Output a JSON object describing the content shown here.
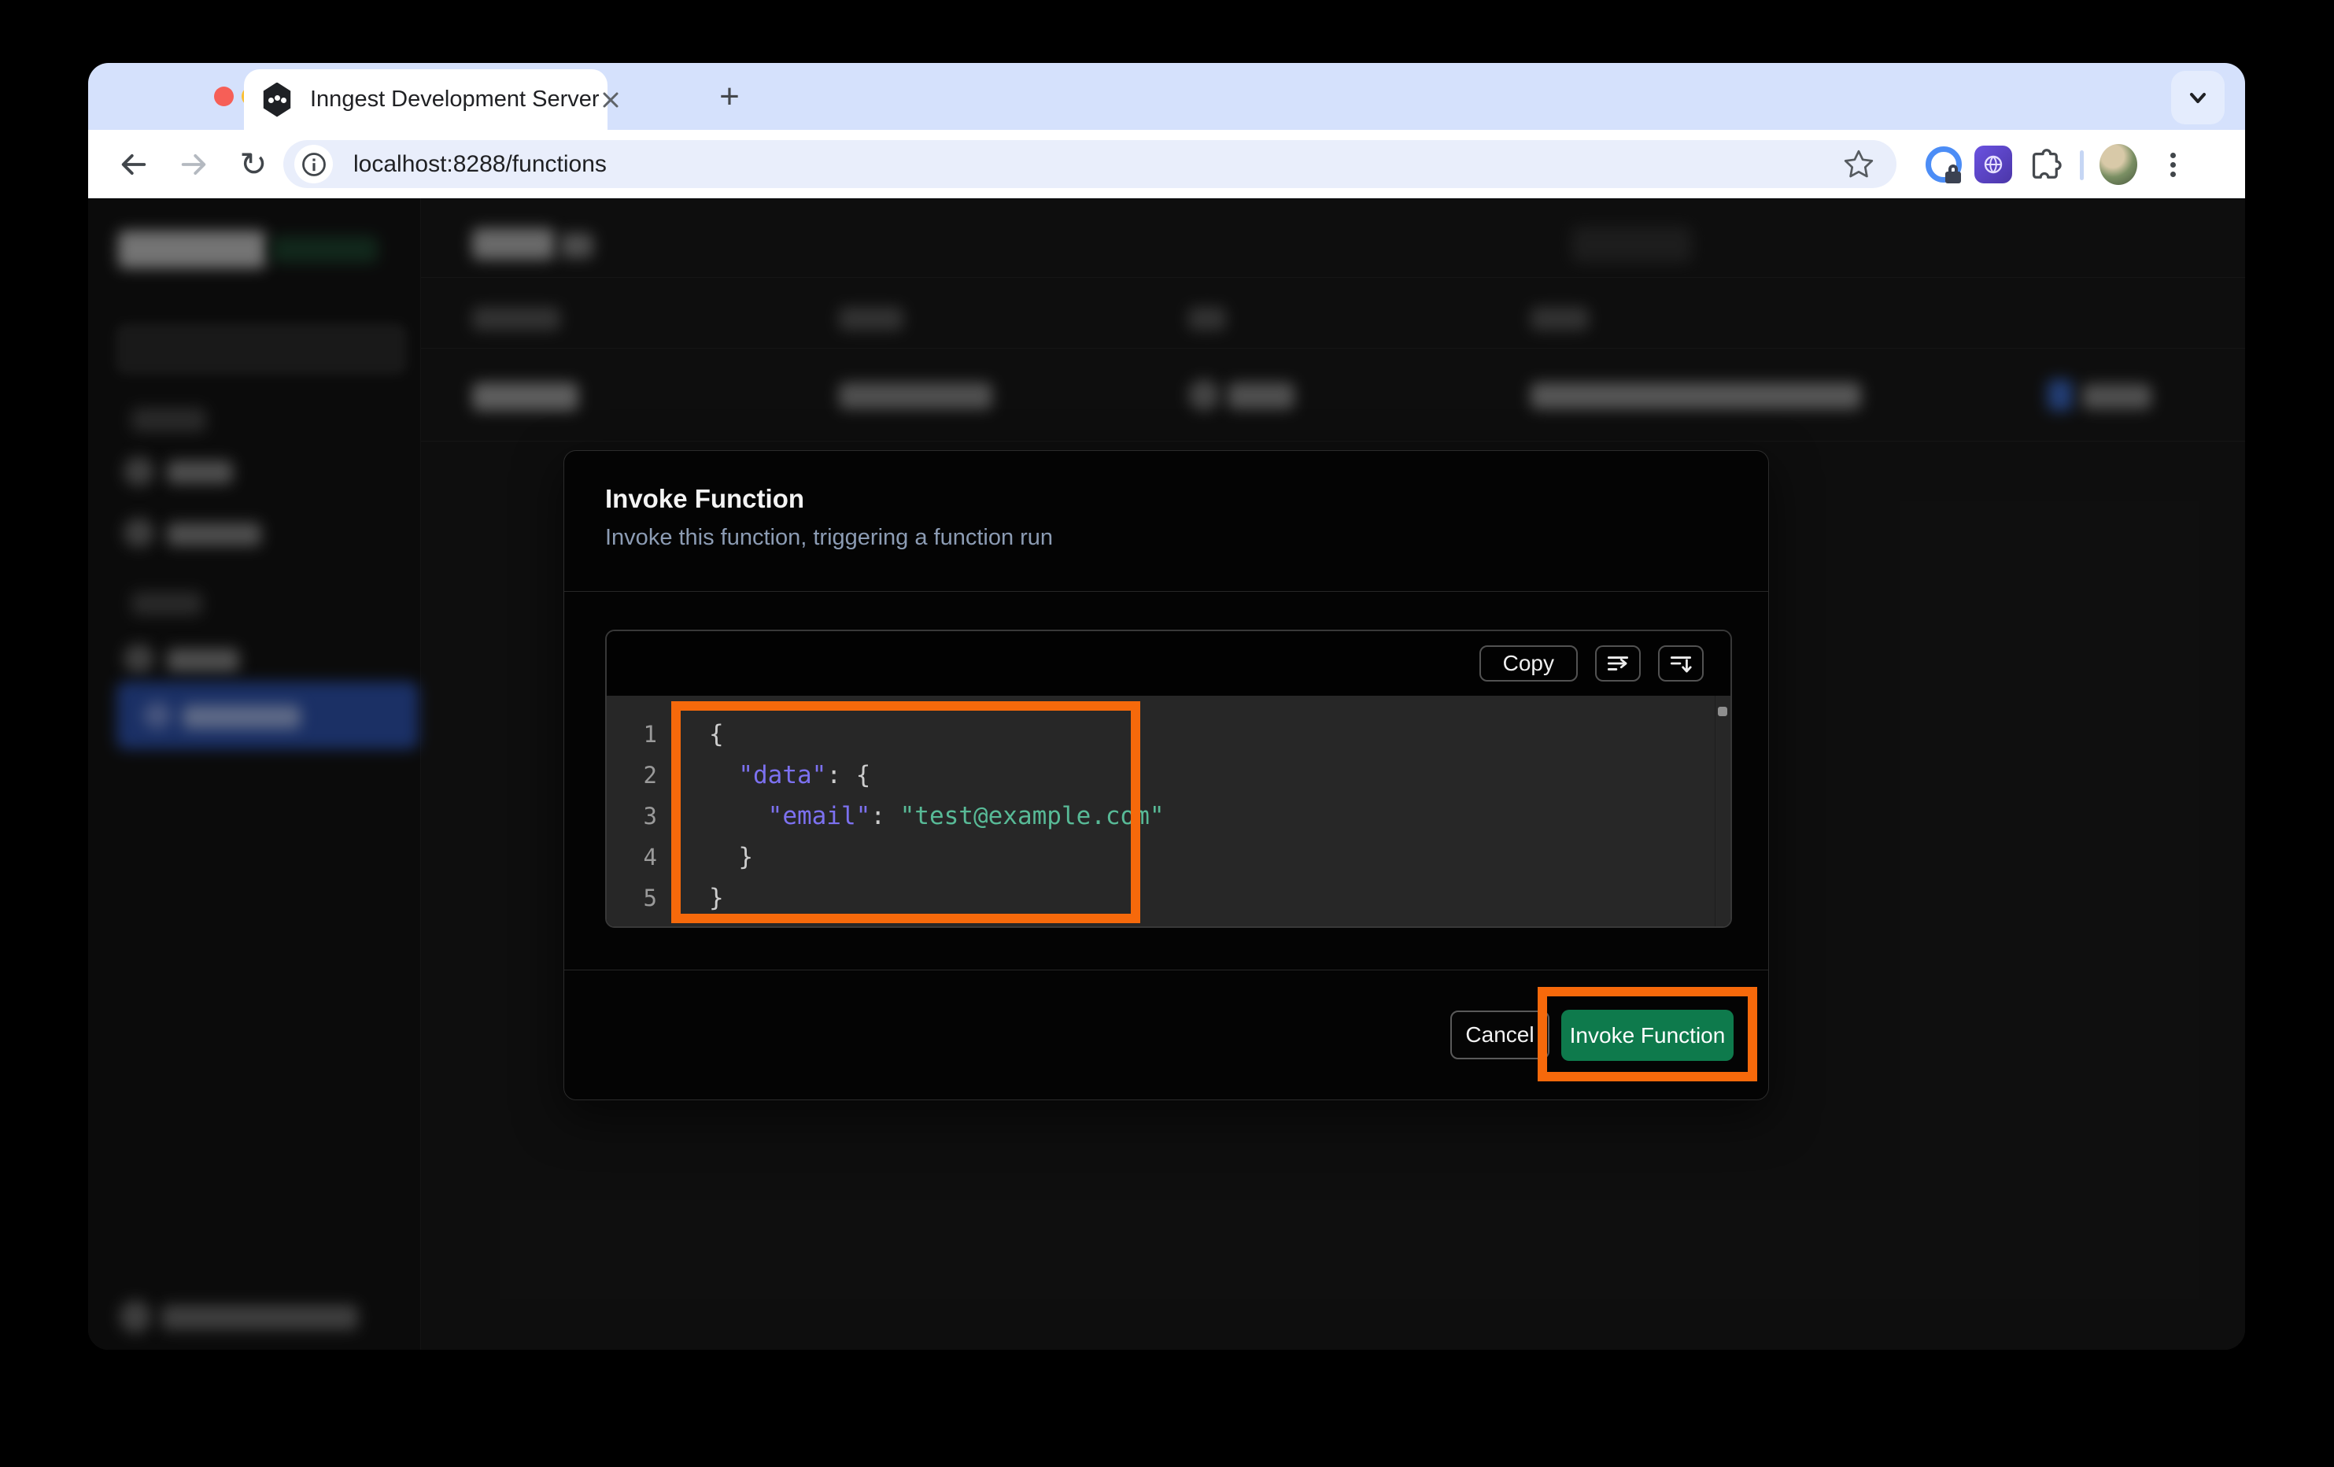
{
  "browser": {
    "tab_title": "Inngest Development Server",
    "new_tab_label": "+",
    "url": "localhost:8288/functions"
  },
  "modal": {
    "title": "Invoke Function",
    "subtitle": "Invoke this function, triggering a function run",
    "copy_label": "Copy",
    "cancel_label": "Cancel",
    "invoke_label": "Invoke Function"
  },
  "code": {
    "lines": [
      {
        "num": "1",
        "tokens": [
          {
            "t": "{",
            "c": "p"
          }
        ]
      },
      {
        "num": "2",
        "tokens": [
          {
            "t": "  ",
            "c": "p"
          },
          {
            "t": "\"data\"",
            "c": "k"
          },
          {
            "t": ": ",
            "c": "p"
          },
          {
            "t": "{",
            "c": "p"
          }
        ]
      },
      {
        "num": "3",
        "tokens": [
          {
            "t": "    ",
            "c": "p"
          },
          {
            "t": "\"email\"",
            "c": "k"
          },
          {
            "t": ": ",
            "c": "p"
          },
          {
            "t": "\"test@example.com\"",
            "c": "s"
          }
        ]
      },
      {
        "num": "4",
        "tokens": [
          {
            "t": "  ",
            "c": "p"
          },
          {
            "t": "}",
            "c": "p"
          }
        ]
      },
      {
        "num": "5",
        "tokens": [
          {
            "t": "}",
            "c": "p"
          }
        ]
      }
    ]
  },
  "colors": {
    "annotation": "#F6690B",
    "green_button": "#0E7A4C",
    "json_key": "#7C71F0",
    "json_string": "#58BA97",
    "selected_nav": "#3056B5"
  }
}
